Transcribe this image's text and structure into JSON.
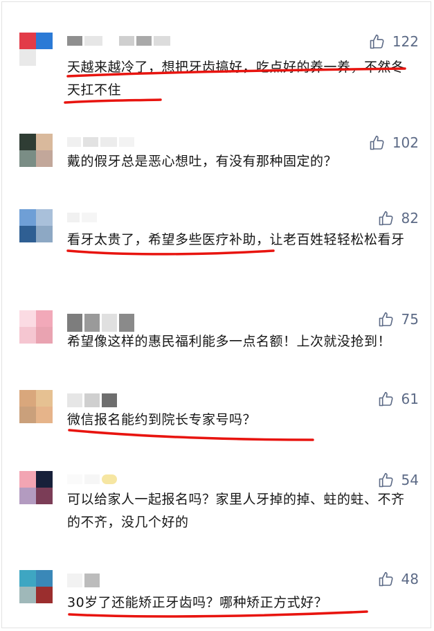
{
  "comments": [
    {
      "likes": "122",
      "text": "天越来越冷了，想把牙齿搞好，吃点好的养一养，不然冬天扛不住",
      "underlined": true,
      "avatar_colors": [
        "#e23b48",
        "#2b7ad6",
        "#e9e9e9",
        "#ffffff"
      ]
    },
    {
      "likes": "102",
      "text": "戴的假牙总是恶心想吐，有没有那种固定的？",
      "underlined": false,
      "avatar_colors": [
        "#2f3d34",
        "#d9b99c",
        "#7a8d85",
        "#c2a79a"
      ]
    },
    {
      "likes": "82",
      "text": "看牙太贵了，希望多些医疗补助，让老百姓轻轻松松看牙",
      "underlined": true,
      "avatar_colors": [
        "#6f9fd6",
        "#a9c0da",
        "#2f5f93",
        "#8da8c4"
      ]
    },
    {
      "likes": "75",
      "text": "希望像这样的惠民福利能多一点名额！上次就没抢到！",
      "underlined": false,
      "avatar_colors": [
        "#fbdbe3",
        "#f2a9b9",
        "#f5c6d1",
        "#e9a3b1"
      ]
    },
    {
      "likes": "61",
      "text": "微信报名能约到院长专家号吗？",
      "underlined": true,
      "avatar_colors": [
        "#d9a77c",
        "#e6c192",
        "#caa07b",
        "#e6b48a"
      ]
    },
    {
      "likes": "54",
      "text": "可以给家人一起报名吗？家里人牙掉的掉、蛀的蛀、不齐的不齐，没几个好的",
      "underlined": false,
      "avatar_colors": [
        "#f2a5b3",
        "#17203a",
        "#b39bc0",
        "#7b3d57"
      ]
    },
    {
      "likes": "48",
      "text": "30岁了还能矫正牙齿吗？哪种矫正方式好？",
      "underlined": true,
      "avatar_colors": [
        "#3ea6c2",
        "#3a88b8",
        "#9fb8b9",
        "#9b2e2e"
      ]
    }
  ],
  "colors": {
    "like": "#5c6a86",
    "underline": "#e8140f",
    "text": "#161616"
  }
}
